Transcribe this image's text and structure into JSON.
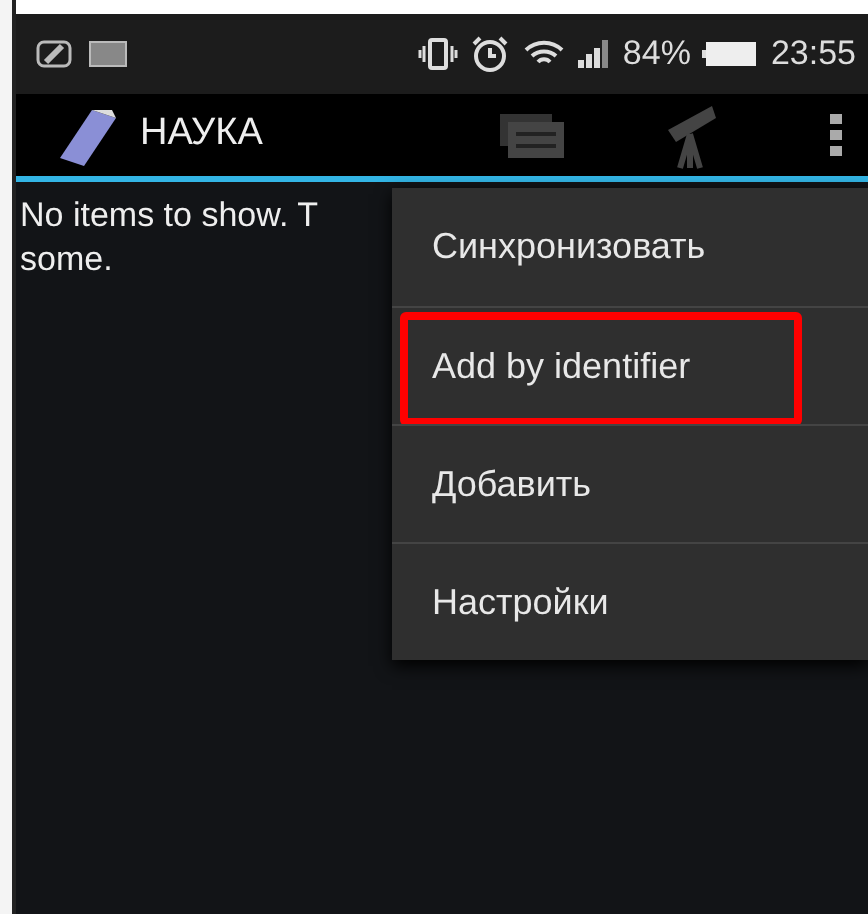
{
  "status_bar": {
    "battery_percent": "84%",
    "time": "23:55"
  },
  "action_bar": {
    "title": "НАУКА"
  },
  "content": {
    "message_lines": [
      "No items to show. T",
      "some."
    ]
  },
  "overflow_menu": {
    "items": [
      {
        "label": "Синхронизовать",
        "annotated": false
      },
      {
        "label": "Add by identifier",
        "annotated": true
      },
      {
        "label": "Добавить",
        "annotated": false
      },
      {
        "label": "Настройки",
        "annotated": false
      }
    ]
  }
}
